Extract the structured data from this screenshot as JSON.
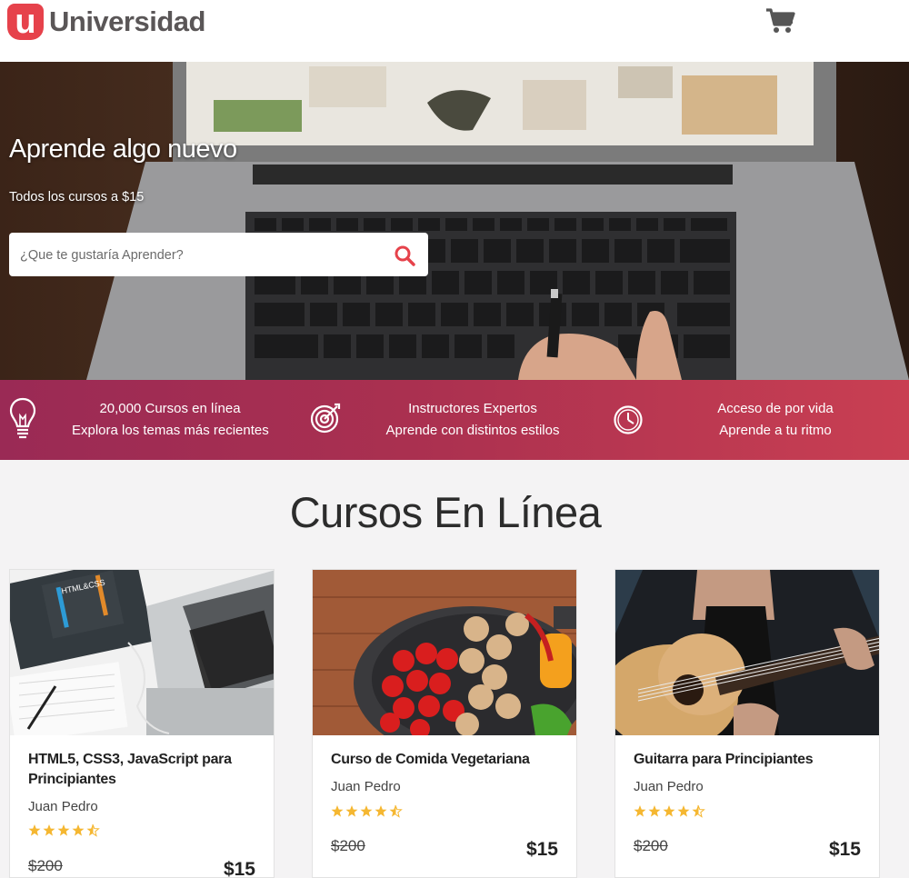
{
  "brand": {
    "mark": "u",
    "name": "Universidad"
  },
  "hero": {
    "title": "Aprende algo nuevo",
    "subtitle": "Todos los cursos a $15",
    "search_placeholder": "¿Que te gustaría Aprender?"
  },
  "benefits": [
    {
      "icon": "lightbulb-icon",
      "line1": "20,000 Cursos en línea",
      "line2": "Explora los temas más recientes"
    },
    {
      "icon": "target-icon",
      "line1": "Instructores Expertos",
      "line2": "Aprende con distintos estilos"
    },
    {
      "icon": "clock-icon",
      "line1": "Acceso de por vida",
      "line2": "Aprende a tu ritmo"
    }
  ],
  "section": {
    "title": "Cursos En Línea"
  },
  "courses": [
    {
      "title": "HTML5, CSS3, JavaScript para Principiantes",
      "author": "Juan Pedro",
      "rating": 4.5,
      "old_price": "$200",
      "price": "$15"
    },
    {
      "title": "Curso de Comida Vegetariana",
      "author": "Juan Pedro",
      "rating": 4.5,
      "old_price": "$200",
      "price": "$15"
    },
    {
      "title": "Guitarra para Principiantes",
      "author": "Juan Pedro",
      "rating": 4.5,
      "old_price": "$200",
      "price": "$15"
    }
  ],
  "colors": {
    "accent": "#e6424b",
    "star": "#f5b731",
    "bar_start": "#9a2a55",
    "bar_end": "#c93f52"
  }
}
